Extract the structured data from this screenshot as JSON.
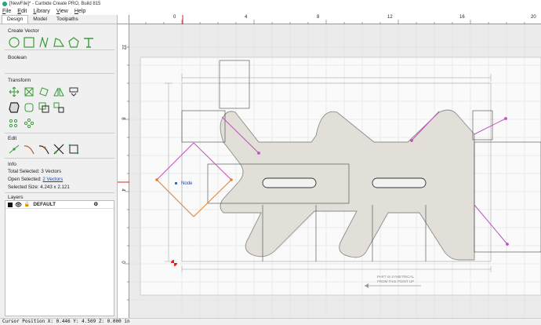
{
  "window": {
    "title": "[NewFile]* - Carbide Create PRO, Build 815"
  },
  "menu": [
    "File",
    "Edit",
    "Library",
    "View",
    "Help"
  ],
  "tabs": [
    "Design",
    "Model",
    "Toolpaths"
  ],
  "sections": {
    "create_vector": "Create Vector",
    "boolean": "Boolean",
    "transform": "Transform",
    "edit": "Edit",
    "info": "Info",
    "layers": "Layers"
  },
  "info": {
    "total_selected_label": "Total Selected:",
    "total_selected_value": "3 Vectors",
    "open_selected_label": "Open Selected:",
    "open_selected_value": "2 Vectors",
    "selected_size_label": "Selected Size:",
    "selected_size_value": "4.243 x 2.121"
  },
  "layers": [
    {
      "name": "DEFAULT",
      "color": "#111111"
    }
  ],
  "rulers": {
    "top": [
      "0",
      "4",
      "8",
      "12",
      "16",
      "20"
    ],
    "left": [
      "12",
      "8",
      "4",
      "0"
    ]
  },
  "canvas": {
    "node_label": "Node",
    "note_line1": "PART IS SYMETRICAL",
    "note_line2": "FROM THIS POINT UP"
  },
  "status": {
    "cursor": "Cursor Position X: 0.446 Y: 4.509 Z: 0.000 in"
  },
  "colors": {
    "selection": "#c050c0",
    "open_vector": "#e08020",
    "part_fill": "#e2dfd8",
    "accent": "#2a7fd0"
  }
}
